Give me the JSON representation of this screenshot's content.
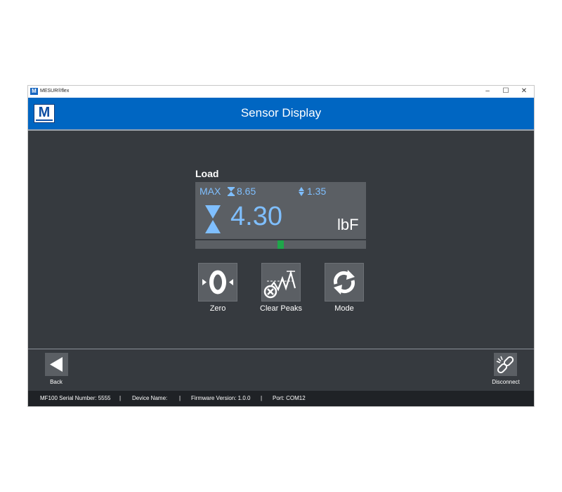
{
  "window": {
    "app_title": "MESUR®flex",
    "logo_letter": "M",
    "controls": {
      "minimize": "–",
      "maximize": "☐",
      "close": "✕"
    }
  },
  "header": {
    "title": "Sensor Display",
    "logo_letter": "M"
  },
  "sensor": {
    "label": "Load",
    "max_label": "MAX",
    "max_value": "8.65",
    "min_value": "1.35",
    "current_value": "4.30",
    "unit": "lbF",
    "bar_position_fraction": 0.5
  },
  "actions": [
    {
      "label": "Zero",
      "icon": "zero-icon"
    },
    {
      "label": "Clear Peaks",
      "icon": "clear-peaks-icon"
    },
    {
      "label": "Mode",
      "icon": "refresh-icon"
    }
  ],
  "footer": {
    "back_label": "Back",
    "disconnect_label": "Disconnect"
  },
  "status": {
    "serial": "MF100 Serial Number: 5555",
    "sep1": "|",
    "device_name": "Device Name:",
    "sep2": "|",
    "firmware": "Firmware Version: 1.0.0",
    "sep3": "|",
    "port": "Port: COM12"
  },
  "colors": {
    "header_blue": "#0066c2",
    "value_blue": "#7fbfff",
    "panel_gray": "#5b5f64",
    "background": "#363a3f",
    "indicator_green": "#1fa64a"
  }
}
